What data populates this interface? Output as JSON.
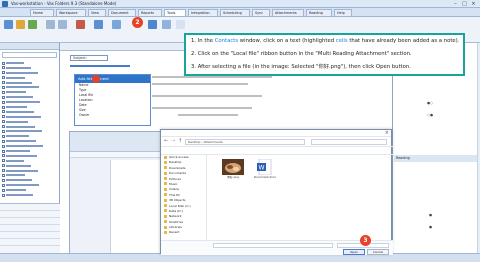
{
  "titlebar": {
    "title": "Vas-workstation  -  Vas Folders 9.3 (Standalone Mode)"
  },
  "tabs": [
    "Home",
    "Workspace",
    "View",
    "Document",
    "Reports",
    "Tools",
    "Integration",
    "Scheduling",
    "Sync",
    "Attachments",
    "Reading",
    "Help"
  ],
  "callout": {
    "step1_pre": "1.  In the ",
    "step1_hl": "Contacts",
    "step1_post": " window, click on a text (highlighted ",
    "step1_hl2": "cells",
    "step1_post2": " that have already been added as a note).",
    "step2": "2.  Click on the \"Local file\" ribbon button in the \"Multi Reading Attachment\" section.",
    "step3": "3.  After selecting a file (in the image: Selected \"你好.png\"), then click Open button."
  },
  "markers": {
    "m2": "2",
    "m3": "3"
  },
  "popup": {
    "title": "Add Attachment",
    "rows": [
      "Name",
      "Type",
      "Local file",
      "Location",
      "Date",
      "Size",
      "Owner"
    ]
  },
  "doc": {
    "field_label": "Subject:"
  },
  "dialog": {
    "address": "Desktop  ›  Attachments",
    "tree": [
      "Quick access",
      "Desktop",
      "Downloads",
      "Documents",
      "Pictures",
      "Music",
      "Videos",
      "This PC",
      "3D Objects",
      "Local Disk (C:)",
      "Data (D:)",
      "Network",
      "OneDrive",
      "Libraries",
      "Recent"
    ],
    "files": [
      {
        "name": "你好.png",
        "icon": "image-thumbnail-icon"
      },
      {
        "name": "Document.docx",
        "icon": "word-document-icon"
      }
    ],
    "open_label": "Open",
    "cancel_label": "Cancel"
  },
  "right": {
    "section": "Reading"
  },
  "colors": {
    "accent": "#1aa39a",
    "marker": "#e9402a",
    "highlight": "#1a7fe0",
    "ribbon_blue": "#2e74c9"
  }
}
